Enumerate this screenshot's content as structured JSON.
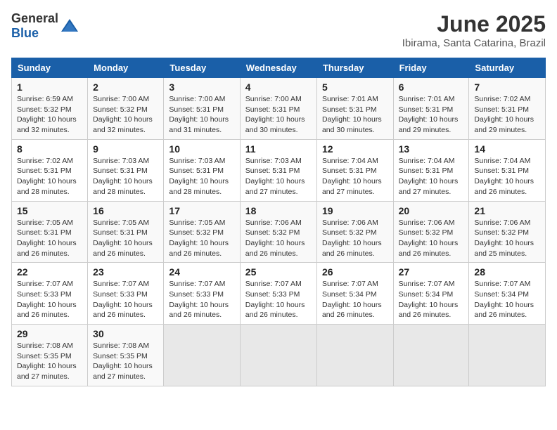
{
  "header": {
    "logo_general": "General",
    "logo_blue": "Blue",
    "month_title": "June 2025",
    "subtitle": "Ibirama, Santa Catarina, Brazil"
  },
  "days_of_week": [
    "Sunday",
    "Monday",
    "Tuesday",
    "Wednesday",
    "Thursday",
    "Friday",
    "Saturday"
  ],
  "weeks": [
    [
      {
        "day": "1",
        "info": "Sunrise: 6:59 AM\nSunset: 5:32 PM\nDaylight: 10 hours\nand 32 minutes."
      },
      {
        "day": "2",
        "info": "Sunrise: 7:00 AM\nSunset: 5:32 PM\nDaylight: 10 hours\nand 32 minutes."
      },
      {
        "day": "3",
        "info": "Sunrise: 7:00 AM\nSunset: 5:31 PM\nDaylight: 10 hours\nand 31 minutes."
      },
      {
        "day": "4",
        "info": "Sunrise: 7:00 AM\nSunset: 5:31 PM\nDaylight: 10 hours\nand 30 minutes."
      },
      {
        "day": "5",
        "info": "Sunrise: 7:01 AM\nSunset: 5:31 PM\nDaylight: 10 hours\nand 30 minutes."
      },
      {
        "day": "6",
        "info": "Sunrise: 7:01 AM\nSunset: 5:31 PM\nDaylight: 10 hours\nand 29 minutes."
      },
      {
        "day": "7",
        "info": "Sunrise: 7:02 AM\nSunset: 5:31 PM\nDaylight: 10 hours\nand 29 minutes."
      }
    ],
    [
      {
        "day": "8",
        "info": "Sunrise: 7:02 AM\nSunset: 5:31 PM\nDaylight: 10 hours\nand 28 minutes."
      },
      {
        "day": "9",
        "info": "Sunrise: 7:03 AM\nSunset: 5:31 PM\nDaylight: 10 hours\nand 28 minutes."
      },
      {
        "day": "10",
        "info": "Sunrise: 7:03 AM\nSunset: 5:31 PM\nDaylight: 10 hours\nand 28 minutes."
      },
      {
        "day": "11",
        "info": "Sunrise: 7:03 AM\nSunset: 5:31 PM\nDaylight: 10 hours\nand 27 minutes."
      },
      {
        "day": "12",
        "info": "Sunrise: 7:04 AM\nSunset: 5:31 PM\nDaylight: 10 hours\nand 27 minutes."
      },
      {
        "day": "13",
        "info": "Sunrise: 7:04 AM\nSunset: 5:31 PM\nDaylight: 10 hours\nand 27 minutes."
      },
      {
        "day": "14",
        "info": "Sunrise: 7:04 AM\nSunset: 5:31 PM\nDaylight: 10 hours\nand 26 minutes."
      }
    ],
    [
      {
        "day": "15",
        "info": "Sunrise: 7:05 AM\nSunset: 5:31 PM\nDaylight: 10 hours\nand 26 minutes."
      },
      {
        "day": "16",
        "info": "Sunrise: 7:05 AM\nSunset: 5:31 PM\nDaylight: 10 hours\nand 26 minutes."
      },
      {
        "day": "17",
        "info": "Sunrise: 7:05 AM\nSunset: 5:32 PM\nDaylight: 10 hours\nand 26 minutes."
      },
      {
        "day": "18",
        "info": "Sunrise: 7:06 AM\nSunset: 5:32 PM\nDaylight: 10 hours\nand 26 minutes."
      },
      {
        "day": "19",
        "info": "Sunrise: 7:06 AM\nSunset: 5:32 PM\nDaylight: 10 hours\nand 26 minutes."
      },
      {
        "day": "20",
        "info": "Sunrise: 7:06 AM\nSunset: 5:32 PM\nDaylight: 10 hours\nand 26 minutes."
      },
      {
        "day": "21",
        "info": "Sunrise: 7:06 AM\nSunset: 5:32 PM\nDaylight: 10 hours\nand 25 minutes."
      }
    ],
    [
      {
        "day": "22",
        "info": "Sunrise: 7:07 AM\nSunset: 5:33 PM\nDaylight: 10 hours\nand 26 minutes."
      },
      {
        "day": "23",
        "info": "Sunrise: 7:07 AM\nSunset: 5:33 PM\nDaylight: 10 hours\nand 26 minutes."
      },
      {
        "day": "24",
        "info": "Sunrise: 7:07 AM\nSunset: 5:33 PM\nDaylight: 10 hours\nand 26 minutes."
      },
      {
        "day": "25",
        "info": "Sunrise: 7:07 AM\nSunset: 5:33 PM\nDaylight: 10 hours\nand 26 minutes."
      },
      {
        "day": "26",
        "info": "Sunrise: 7:07 AM\nSunset: 5:34 PM\nDaylight: 10 hours\nand 26 minutes."
      },
      {
        "day": "27",
        "info": "Sunrise: 7:07 AM\nSunset: 5:34 PM\nDaylight: 10 hours\nand 26 minutes."
      },
      {
        "day": "28",
        "info": "Sunrise: 7:07 AM\nSunset: 5:34 PM\nDaylight: 10 hours\nand 26 minutes."
      }
    ],
    [
      {
        "day": "29",
        "info": "Sunrise: 7:08 AM\nSunset: 5:35 PM\nDaylight: 10 hours\nand 27 minutes."
      },
      {
        "day": "30",
        "info": "Sunrise: 7:08 AM\nSunset: 5:35 PM\nDaylight: 10 hours\nand 27 minutes."
      },
      {
        "day": "",
        "info": ""
      },
      {
        "day": "",
        "info": ""
      },
      {
        "day": "",
        "info": ""
      },
      {
        "day": "",
        "info": ""
      },
      {
        "day": "",
        "info": ""
      }
    ]
  ]
}
